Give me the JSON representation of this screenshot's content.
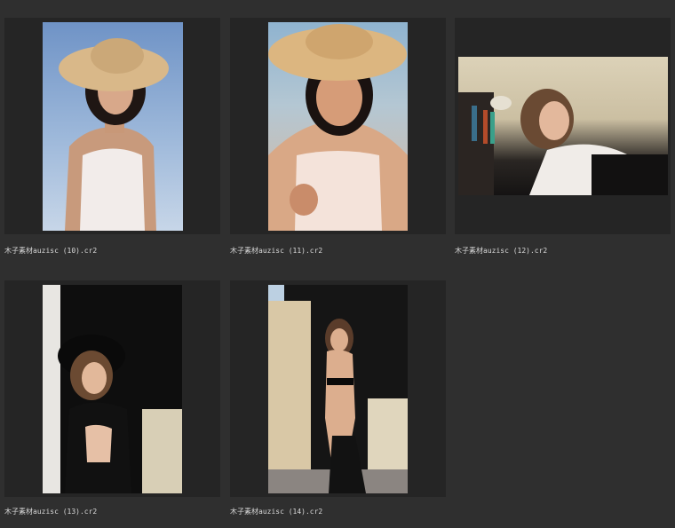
{
  "gallery": {
    "items": [
      {
        "filename": "木子素材auzisc (10).cr2"
      },
      {
        "filename": "木子素材auzisc (11).cr2"
      },
      {
        "filename": "木子素材auzisc (12).cr2"
      },
      {
        "filename": "木子素材auzisc (13).cr2"
      },
      {
        "filename": "木子素材auzisc (14).cr2"
      }
    ]
  },
  "colors": {
    "background": "#2f2f2f",
    "thumbnail_frame": "#252525",
    "caption_text": "#d8d8d8"
  }
}
